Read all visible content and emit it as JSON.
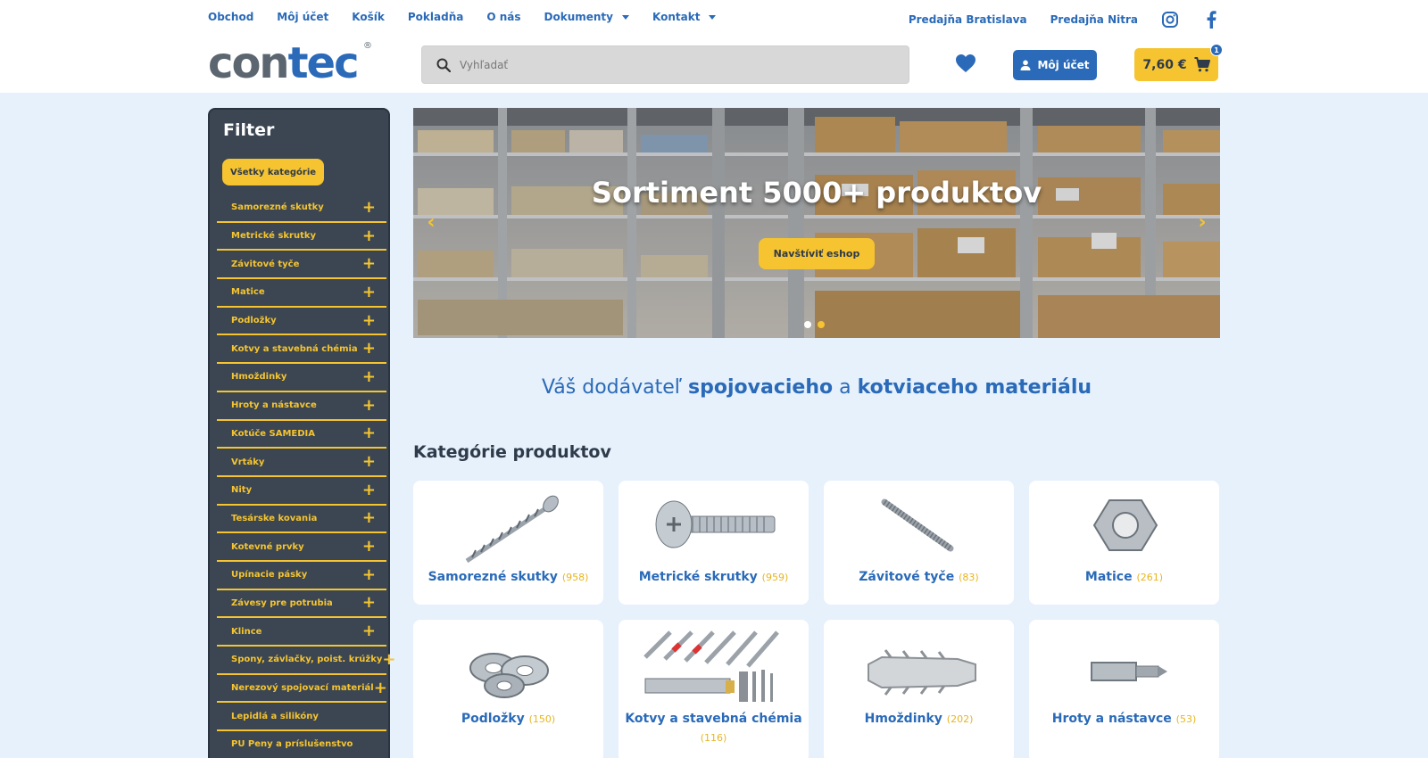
{
  "topnav": {
    "items": [
      "Obchod",
      "Môj účet",
      "Košík",
      "Pokladňa",
      "O nás",
      "Dokumenty",
      "Kontakt"
    ],
    "stores": [
      "Predajňa Bratislava",
      "Predajňa Nitra"
    ]
  },
  "logo": {
    "part1": "con",
    "part2": "tec",
    "reg": "®"
  },
  "search": {
    "placeholder": "Vyhľadať"
  },
  "account": {
    "label": "Môj účet"
  },
  "cart": {
    "total": "7,60 €",
    "count": "1"
  },
  "sidebar": {
    "title": "Filter",
    "all_label": "Všetky kategórie",
    "items": [
      "Samorezné skutky",
      "Metrické skrutky",
      "Závitové tyče",
      "Matice",
      "Podložky",
      "Kotvy a stavebná chémia",
      "Hmoždinky",
      "Hroty a nástavce",
      "Kotúče SAMEDIA",
      "Vrtáky",
      "Nity",
      "Tesárske kovania",
      "Kotevné prvky",
      "Upínacie pásky",
      "Závesy pre potrubia",
      "Klince",
      "Spony, závlačky, poist. krúžky",
      "Nerezový spojovací materiál",
      "Lepidlá a silikóny",
      "PU Peny a príslušenstvo"
    ]
  },
  "hero": {
    "title": "Sortiment 5000+ produktov",
    "button": "Navštíviť eshop",
    "slide_count": 2,
    "active_slide": 2
  },
  "tagline": {
    "part1": "Váš dodávateľ ",
    "bold1": "spojovacieho",
    "part2": " a ",
    "bold2": "kotviaceho materiálu"
  },
  "categories_title": "Kategórie produktov",
  "categories": [
    {
      "name": "Samorezné skutky",
      "count": "(958)"
    },
    {
      "name": "Metrické skrutky",
      "count": "(959)"
    },
    {
      "name": "Závitové tyče",
      "count": "(83)"
    },
    {
      "name": "Matice",
      "count": "(261)"
    },
    {
      "name": "Podložky",
      "count": "(150)"
    },
    {
      "name": "Kotvy a stavebná chémia",
      "count": "(116)"
    },
    {
      "name": "Hmoždinky",
      "count": "(202)"
    },
    {
      "name": "Hroty a nástavce",
      "count": "(53)"
    }
  ],
  "colors": {
    "blue": "#2a6ab8",
    "yellow": "#f5c430",
    "sidebar": "#3b4652",
    "bg": "#e6f1fc"
  }
}
